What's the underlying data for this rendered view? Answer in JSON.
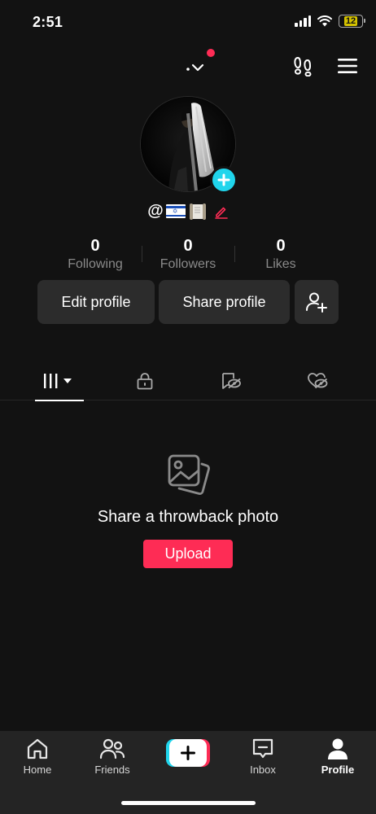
{
  "status_bar": {
    "time": "2:51",
    "battery_level": "12",
    "icons": [
      "signal-icon",
      "wifi-icon",
      "battery-icon"
    ]
  },
  "top_bar": {
    "icons": [
      "account-switch-icon",
      "footprint-icon",
      "menu-icon"
    ],
    "has_notification": true
  },
  "profile": {
    "username_prefix": "@",
    "username_emoji": [
      "israel-flag",
      "scroll"
    ],
    "stats": [
      {
        "value": "0",
        "label": "Following"
      },
      {
        "value": "0",
        "label": "Followers"
      },
      {
        "value": "0",
        "label": "Likes"
      }
    ],
    "edit_label": "Edit profile",
    "share_label": "Share profile"
  },
  "tabs": [
    {
      "icon": "videos-grid-icon",
      "active": true
    },
    {
      "icon": "lock-icon",
      "active": false
    },
    {
      "icon": "reposts-icon",
      "active": false
    },
    {
      "icon": "liked-hidden-icon",
      "active": false
    }
  ],
  "empty_state": {
    "title": "Share a throwback photo",
    "button": "Upload"
  },
  "bottom_nav": {
    "items": [
      {
        "label": "Home",
        "icon": "home-icon"
      },
      {
        "label": "Friends",
        "icon": "friends-icon"
      },
      {
        "label": "Inbox",
        "icon": "inbox-icon"
      },
      {
        "label": "Profile",
        "icon": "profile-icon"
      }
    ],
    "active": "Profile"
  },
  "colors": {
    "background": "#121212",
    "accent_red": "#fe2c55",
    "accent_cyan": "#20d5ec",
    "button_bg": "#2c2c2c",
    "nav_bg": "#242424"
  }
}
